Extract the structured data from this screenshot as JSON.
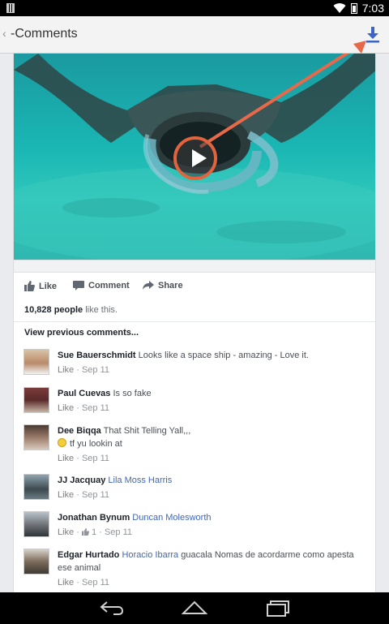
{
  "status_bar": {
    "time": "7:03"
  },
  "app_bar": {
    "back_glyph": "‹",
    "title": "-Comments"
  },
  "actions": {
    "like": "Like",
    "comment": "Comment",
    "share": "Share"
  },
  "likes": {
    "count": "10,828 people",
    "rest": "like this."
  },
  "view_previous": "View previous comments...",
  "comments": [
    {
      "name": "Sue Bauerschmidt",
      "text": "Looks like a space ship - amazing - Love it.",
      "line2": "",
      "like": "Like",
      "likes_count": "",
      "time": "Sep 11"
    },
    {
      "name": "Paul Cuevas",
      "text": "Is so fake",
      "line2": "",
      "like": "Like",
      "likes_count": "",
      "time": "Sep 11"
    },
    {
      "name": "Dee Biqqa",
      "text": "That Shit Telling Yall,,,",
      "line2": "tf yu lookin at",
      "like": "Like",
      "likes_count": "",
      "time": "Sep 11"
    },
    {
      "name": "JJ Jacquay",
      "text": "Lila Moss Harris",
      "line2": "",
      "like": "Like",
      "likes_count": "",
      "time": "Sep 11"
    },
    {
      "name": "Jonathan Bynum",
      "text": "Duncan Molesworth",
      "line2": "",
      "like": "Like",
      "likes_count": "1",
      "time": "Sep 11"
    },
    {
      "name": "Edgar Hurtado",
      "text": "Horacio Ibarra",
      "text2": "guacala Nomas de acordarme como apesta ese animal",
      "like": "Like",
      "likes_count": "",
      "time": "Sep 11"
    }
  ],
  "colors": {
    "annotation_arrow": "#e8694a",
    "link": "#4267b2",
    "download_icon": "#3b64c4"
  }
}
